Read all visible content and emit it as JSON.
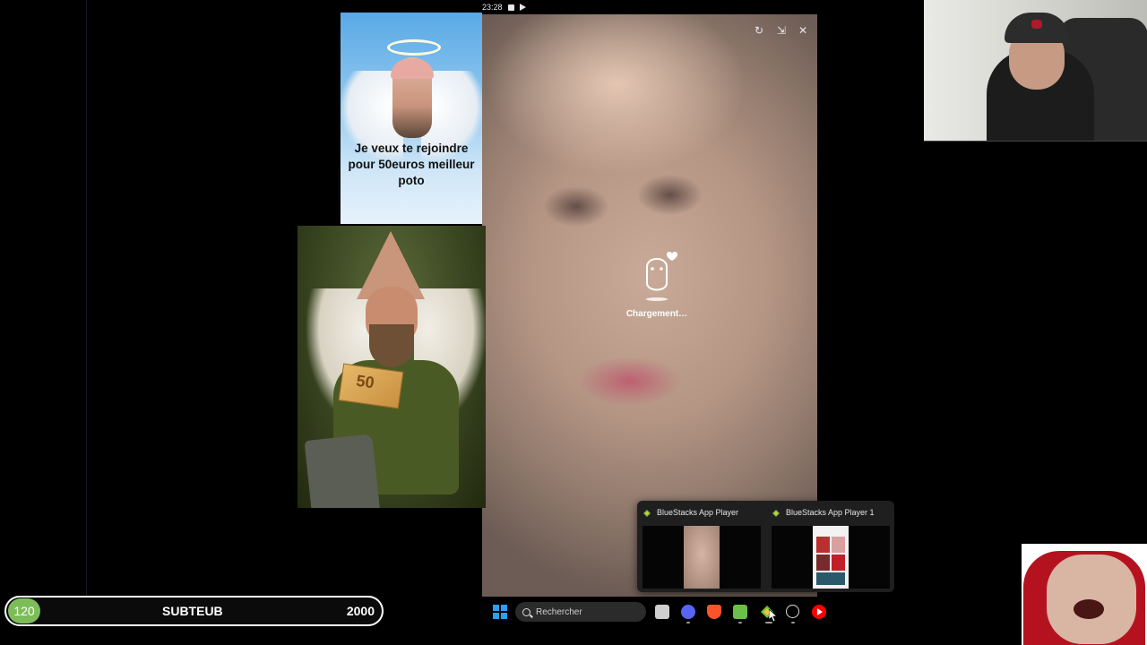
{
  "status_bar": {
    "time": "23:28"
  },
  "phone": {
    "loading_text": "Chargement…",
    "controls": [
      "refresh-icon",
      "minimize-icon",
      "close-icon"
    ]
  },
  "meme": {
    "caption": "Je veux te rejoindre pour 50euros meilleur poto",
    "banknote_value": "50"
  },
  "sub_goal": {
    "current": "120",
    "label": "SUBTEUB",
    "target": "2000"
  },
  "taskbar": {
    "search_placeholder": "Rechercher",
    "icons": [
      "windows-start-icon",
      "search-icon",
      "task-view-icon",
      "discord-icon",
      "brave-icon",
      "green-app-icon",
      "bluestacks-icon",
      "obs-icon",
      "youtube-icon"
    ],
    "colors": {
      "start": "#2b9ff3",
      "discord": "#5865f2",
      "brave": "#fb542b",
      "youtube": "#ff0000",
      "green": "#6cc04a"
    }
  },
  "task_preview": {
    "windows": [
      {
        "title": "BlueStacks App Player"
      },
      {
        "title": "BlueStacks App Player 1"
      }
    ]
  }
}
